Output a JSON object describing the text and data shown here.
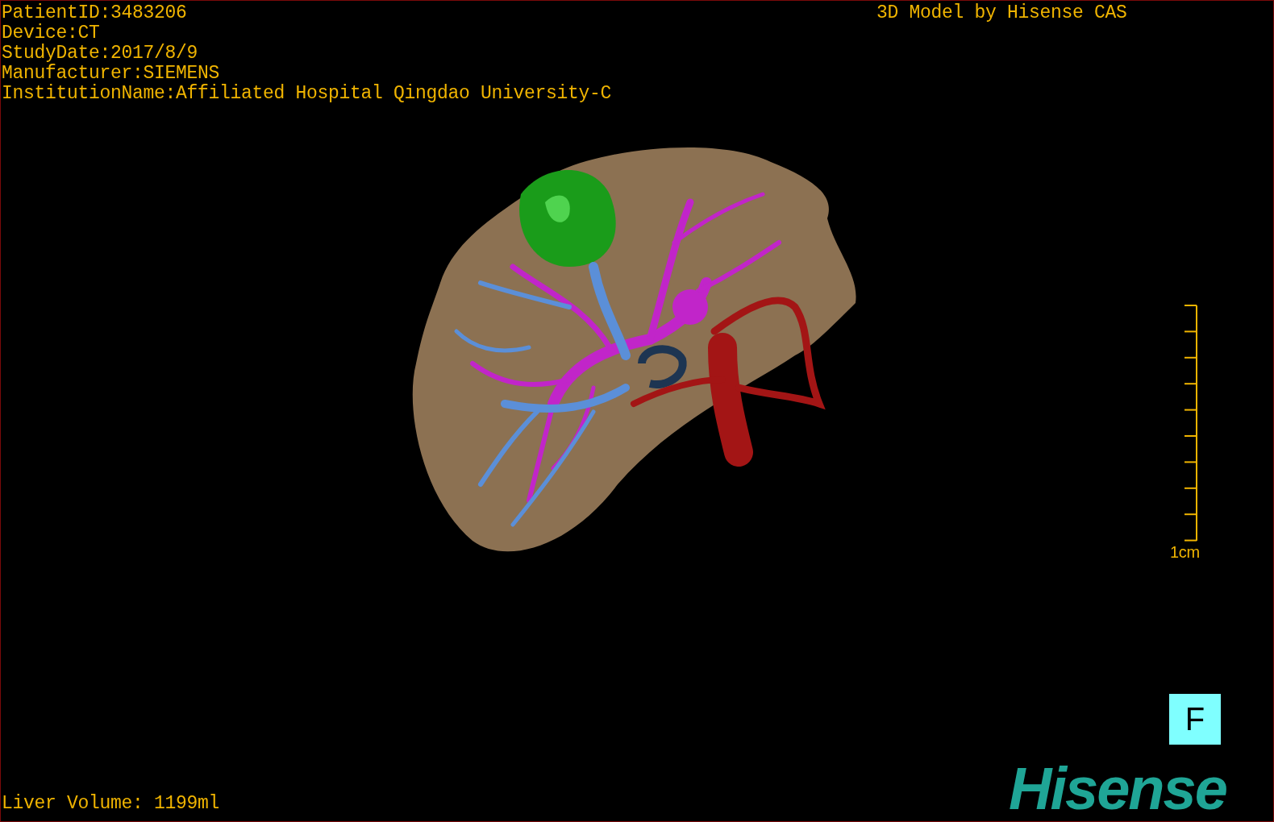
{
  "info_lines": [
    "PatientID:3483206",
    "Device:CT",
    "StudyDate:2017/8/9",
    "Manufacturer:SIEMENS",
    "InstitutionName:Affiliated Hospital Qingdao University-C"
  ],
  "header_right": "3D Model by Hisense CAS",
  "scale_bar": {
    "label": "1cm"
  },
  "orientation_button": "F",
  "liver_volume": "Liver Volume: 1199ml",
  "logo": "Hisense"
}
